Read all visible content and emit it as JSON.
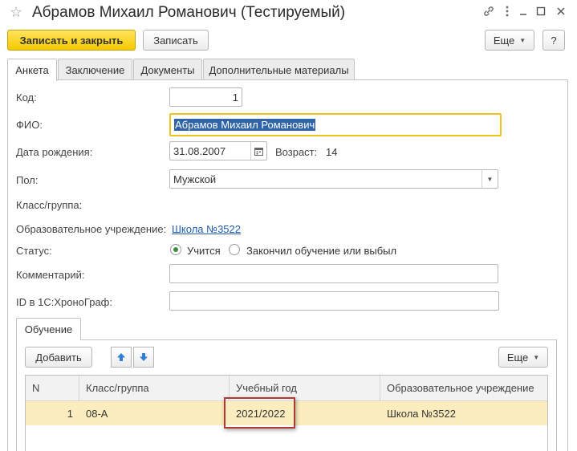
{
  "window": {
    "title": "Абрамов Михаил Романович (Тестируемый)",
    "icons": [
      "star-icon",
      "link-icon",
      "more-icon",
      "minimize-icon",
      "maximize-icon",
      "close-icon"
    ]
  },
  "toolbar": {
    "save_close_label": "Записать и закрыть",
    "save_label": "Записать",
    "more_label": "Еще",
    "help_label": "?"
  },
  "tabs": [
    {
      "label": "Анкета",
      "active": true
    },
    {
      "label": "Заключение",
      "active": false
    },
    {
      "label": "Документы",
      "active": false
    },
    {
      "label": "Дополнительные материалы",
      "active": false
    }
  ],
  "form": {
    "code_label": "Код:",
    "code_value": "1",
    "fio_label": "ФИО:",
    "fio_value": "Абрамов Михаил Романович",
    "birth_label": "Дата рождения:",
    "birth_value": "31.08.2007",
    "age_label": "Возраст:",
    "age_value": "14",
    "gender_label": "Пол:",
    "gender_value": "Мужской",
    "class_label": "Класс/группа:",
    "school_label": "Образовательное учреждение:",
    "school_value": "Школа №3522",
    "status_label": "Статус:",
    "status_options": [
      {
        "label": "Учится",
        "checked": true
      },
      {
        "label": "Закончил обучение или выбыл",
        "checked": false
      }
    ],
    "comment_label": "Комментарий:",
    "comment_value": "",
    "id_label": "ID в 1С:ХроноГраф:",
    "id_value": ""
  },
  "education": {
    "tab_label": "Обучение",
    "add_label": "Добавить",
    "more_label": "Еще",
    "columns": [
      "N",
      "Класс/группа",
      "Учебный год",
      "Образовательное учреждение"
    ],
    "rows": [
      {
        "n": "1",
        "class": "08-А",
        "year": "2021/2022",
        "school": "Школа №3522"
      }
    ]
  },
  "colors": {
    "primary_button": "#f5c900",
    "selected_row": "#fbedbe",
    "highlight_box": "#b13a35",
    "focus_border": "#f1c21b",
    "link": "#1f5bb0"
  }
}
